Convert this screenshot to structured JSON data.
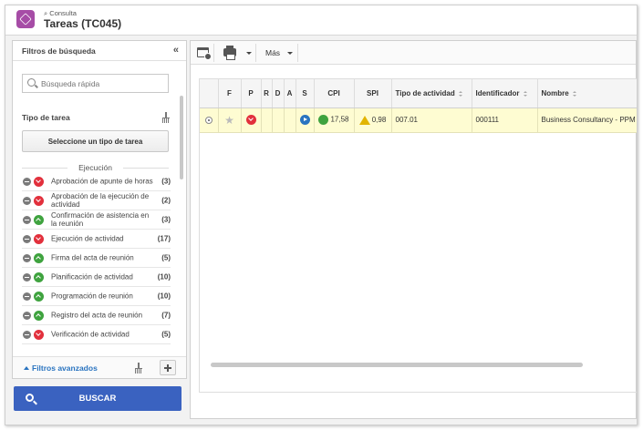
{
  "header": {
    "breadcrumb": "Consulta",
    "title": "Tareas (TC045)"
  },
  "sidebar": {
    "title": "Filtros de búsqueda",
    "search_placeholder": "Búsqueda rápida",
    "task_type_label": "Tipo de tarea",
    "select_type_button": "Seleccione un tipo de tarea",
    "group_label": "Ejecución",
    "items": [
      {
        "label": "Aprobación de apunte de horas",
        "count": "(3)",
        "status": "down"
      },
      {
        "label": "Aprobación de la ejecución de actividad",
        "count": "(2)",
        "status": "down"
      },
      {
        "label": "Confirmación de asistencia en la reunión",
        "count": "(3)",
        "status": "up"
      },
      {
        "label": "Ejecución de actividad",
        "count": "(17)",
        "status": "down"
      },
      {
        "label": "Firma del acta de reunión",
        "count": "(5)",
        "status": "up"
      },
      {
        "label": "Planificación de actividad",
        "count": "(10)",
        "status": "up"
      },
      {
        "label": "Programación de reunión",
        "count": "(10)",
        "status": "up"
      },
      {
        "label": "Registro del acta de reunión",
        "count": "(7)",
        "status": "up"
      },
      {
        "label": "Verificación de actividad",
        "count": "(5)",
        "status": "down"
      }
    ],
    "advanced_filters": "Filtros avanzados",
    "search_button": "BUSCAR"
  },
  "toolbar": {
    "more_label": "Más"
  },
  "grid": {
    "columns": [
      "F",
      "P",
      "R",
      "D",
      "A",
      "S",
      "CPI",
      "SPI",
      "Tipo de actividad",
      "Identificador",
      "Nombre"
    ],
    "rows": [
      {
        "cpi": "17,58",
        "spi": "0,98",
        "activity_type": "007.01",
        "identifier": "000111",
        "name": "Business Consultancy - PPM"
      }
    ]
  },
  "colors": {
    "accent": "#3a62c0",
    "app_icon": "#a64ca6",
    "status_red": "#e2303c",
    "status_green": "#3fa33f",
    "row_highlight": "#fefcd2"
  }
}
